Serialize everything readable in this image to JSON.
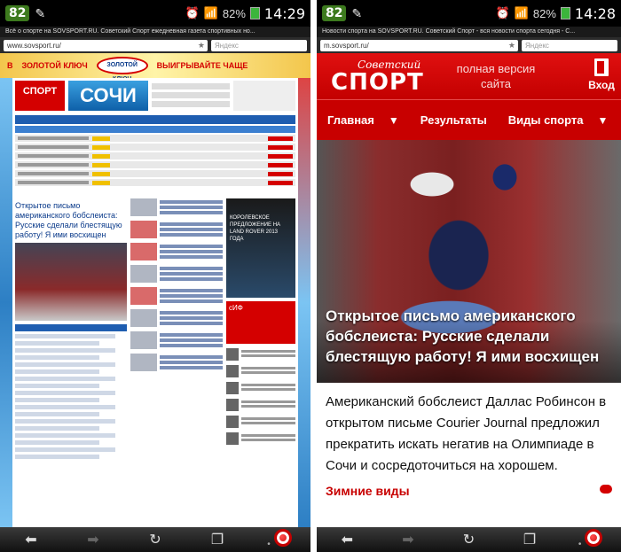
{
  "left": {
    "status": {
      "badge": "82",
      "battery": "82%",
      "time": "14:29"
    },
    "page_title": "Всё о спорте на SOVSPORT.RU. Советский Спорт ежедневная газета спортивных но...",
    "address": {
      "url": "www.sovsport.ru/",
      "search_placeholder": "Яндекс"
    },
    "banner": {
      "word1": "В",
      "word2": "ЗОЛОТОЙ КЛЮЧ",
      "logo": "ЗОЛОТОЙ КЛЮЧ",
      "slogan": "ВЫИГРЫВАЙТЕ ЧАЩЕ"
    },
    "header": {
      "logo": "СПОРТ",
      "sochi": "СОЧИ",
      "ad_text": "КОРОЛЕВСКОЕ ПРЕДЛОЖЕНИЕ НА LAND ROVER 2013 ГОДА",
      "promo": "сИФ"
    },
    "lead": {
      "headline": "Открытое письмо американского бобслеиста: Русские сделали блестящую работу! Я ими восхищен"
    }
  },
  "right": {
    "status": {
      "badge": "82",
      "battery": "82%",
      "time": "14:28"
    },
    "page_title": "Новости спорта на SOVSPORT.RU. Советский Спорт - вся новости спорта сегодня - С...",
    "address": {
      "url": "m.sovsport.ru/",
      "search_placeholder": "Яндекс"
    },
    "header": {
      "logo_small": "Советский",
      "logo_big": "СПОРТ",
      "full_version": "полная версия сайта",
      "login": "Вход"
    },
    "nav": {
      "main": "Главная",
      "results": "Результаты",
      "sports": "Виды спорта"
    },
    "article": {
      "caption": "Открытое письмо американского бобслеиста: Русские сделали блестящую работу! Я ими восхищен",
      "lead": "Американский бобслеист Даллас Робинсон в открытом письме Courier Journal предложил прекратить искать негатив на Олимпиаде в Сочи и сосредоточиться на хорошем.",
      "tag": "Зимние виды"
    }
  },
  "colors": {
    "brand_red": "#c80000",
    "status_green": "#3d7a1e",
    "desktop_nav_blue": "#1e5db0"
  },
  "icons": {
    "back": "back-arrow-icon",
    "forward": "forward-arrow-icon",
    "reload": "reload-icon",
    "tabs": "tabs-icon",
    "browser": "opera-icon"
  }
}
